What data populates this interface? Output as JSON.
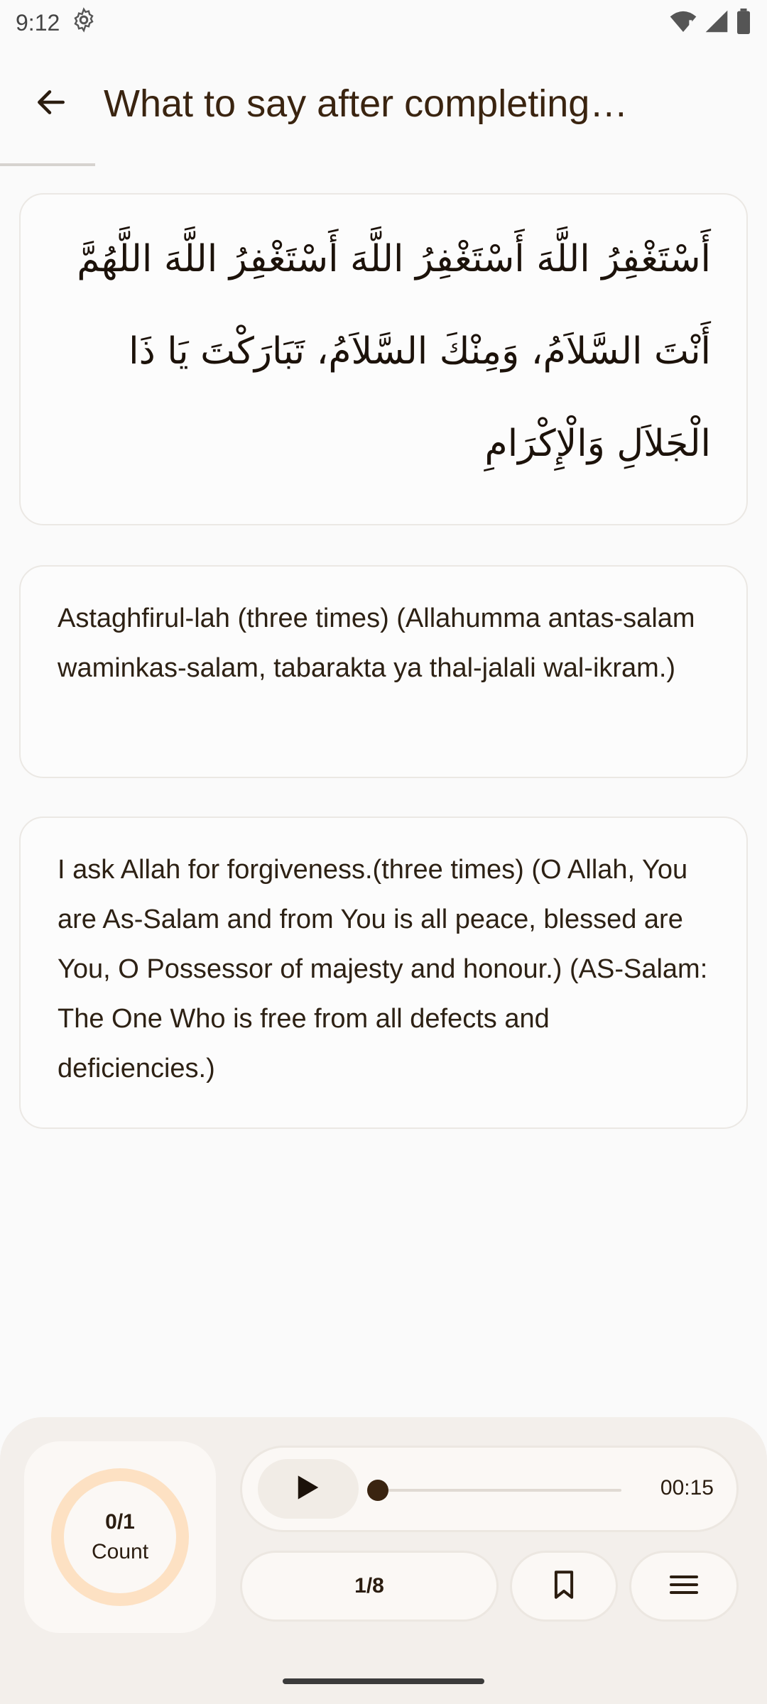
{
  "status_bar": {
    "time": "9:12",
    "icons": [
      "settings-gear-icon",
      "wifi-icon",
      "signal-icon",
      "battery-icon"
    ]
  },
  "app_bar": {
    "back_icon": "arrow-back-icon",
    "title": "What to say after completing…"
  },
  "content": {
    "arabic": "أَسْتَغْفِرُ اللَّهَ   أَسْتَغْفِرُ اللَّهَ   أَسْتَغْفِرُ اللَّهَ   اللَّهُمَّ أَنْتَ السَّلاَمُ، وَمِنْكَ السَّلاَمُ، تَبَارَكْتَ يَا ذَا الْجَلاَلِ وَالْإِكْرَامِ",
    "transliteration": "Astaghfirul-lah (three times) (Allahumma antas-salam waminkas-salam, tabarakta ya thal-jalali wal-ikram.)",
    "translation": "I ask Allah for forgiveness.(three times) (O Allah, You are As-Salam and from You is all peace, blessed are You, O Possessor of majesty and honour.) (AS-Salam: The One Who is free from all defects and deficiencies.)"
  },
  "bottom_bar": {
    "count_value": "0/1",
    "count_label": "Count",
    "player_time": "00:15",
    "play_icon": "play-icon",
    "page_indicator": "1/8",
    "bookmark_icon": "bookmark-icon",
    "menu_icon": "menu-icon"
  },
  "colors": {
    "accent": "#3a2410",
    "ring": "#fde1c3",
    "panel": "#f3efeb"
  }
}
